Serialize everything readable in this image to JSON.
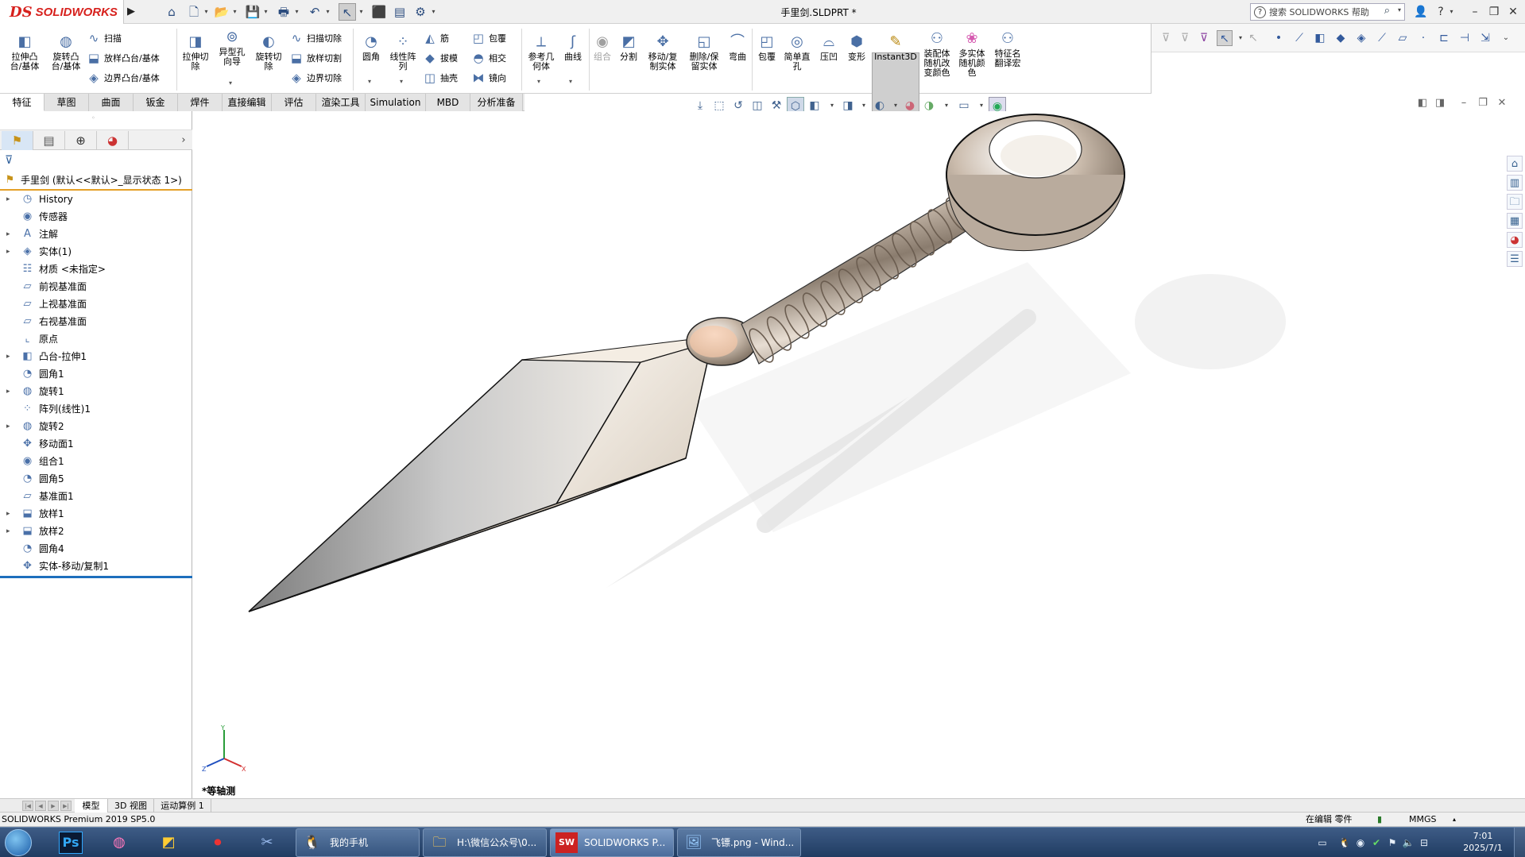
{
  "app": {
    "logo_ds": "DS",
    "logo_text": "SOLIDWORKS",
    "doc_title": "手里剑.SLDPRT *",
    "search_placeholder": "搜索 SOLIDWORKS 帮助"
  },
  "ribbon": {
    "big_buttons": [
      {
        "id": "extrude-boss",
        "label": "拉伸凸\n台/基体",
        "icon": "extrude-boss-icon"
      },
      {
        "id": "revolve-boss",
        "label": "旋转凸\n台/基体",
        "icon": "revolve-boss-icon"
      },
      {
        "id": "extrude-cut",
        "label": "拉伸切\n除",
        "icon": "extrude-cut-icon"
      },
      {
        "id": "hole-wizard",
        "label": "异型孔\n向导",
        "icon": "hole-wizard-icon"
      },
      {
        "id": "revolve-cut",
        "label": "旋转切\n除",
        "icon": "revolve-cut-icon"
      },
      {
        "id": "fillet",
        "label": "圆角",
        "icon": "fillet-icon"
      },
      {
        "id": "linear-pattern",
        "label": "线性阵\n列",
        "icon": "linear-pattern-icon"
      },
      {
        "id": "ref-geometry",
        "label": "参考几\n何体",
        "icon": "reference-geometry-icon"
      },
      {
        "id": "curves",
        "label": "曲线",
        "icon": "curves-icon"
      },
      {
        "id": "combine",
        "label": "组合",
        "icon": "combine-icon"
      },
      {
        "id": "split",
        "label": "分割",
        "icon": "split-icon"
      },
      {
        "id": "move-copy-body",
        "label": "移动/复\n制实体",
        "icon": "move-copy-body-icon"
      },
      {
        "id": "delete-keep-body",
        "label": "删除/保\n留实体",
        "icon": "delete-keep-body-icon"
      },
      {
        "id": "flex",
        "label": "弯曲",
        "icon": "flex-icon"
      },
      {
        "id": "wrap",
        "label": "包覆",
        "icon": "wrap-icon"
      },
      {
        "id": "simple-hole",
        "label": "简单直\n孔",
        "icon": "simple-hole-icon"
      },
      {
        "id": "indent",
        "label": "压凹",
        "icon": "indent-icon"
      },
      {
        "id": "deform",
        "label": "变形",
        "icon": "deform-icon"
      },
      {
        "id": "instant3d",
        "label": "Instant3D",
        "icon": "instant3d-icon"
      },
      {
        "id": "assembly-random-color",
        "label": "装配体\n随机改\n变颜色",
        "icon": "assembly-color-icon"
      },
      {
        "id": "multibody-random-color",
        "label": "多实体\n随机颜\n色",
        "icon": "multibody-color-icon"
      },
      {
        "id": "feature-name-translate",
        "label": "特征名\n翻译宏",
        "icon": "macro-icon"
      }
    ],
    "small_buttons": [
      {
        "id": "sweep",
        "label": "扫描",
        "icon": "sweep-icon"
      },
      {
        "id": "loft-boss",
        "label": "放样凸台/基体",
        "icon": "loft-boss-icon"
      },
      {
        "id": "boundary-boss",
        "label": "边界凸台/基体",
        "icon": "boundary-boss-icon"
      },
      {
        "id": "swept-cut",
        "label": "扫描切除",
        "icon": "swept-cut-icon"
      },
      {
        "id": "lofted-cut",
        "label": "放样切割",
        "icon": "lofted-cut-icon"
      },
      {
        "id": "boundary-cut",
        "label": "边界切除",
        "icon": "boundary-cut-icon"
      },
      {
        "id": "rib",
        "label": "筋",
        "icon": "rib-icon"
      },
      {
        "id": "draft",
        "label": "拔模",
        "icon": "draft-icon"
      },
      {
        "id": "shell",
        "label": "抽壳",
        "icon": "shell-icon"
      },
      {
        "id": "wrap-small",
        "label": "包覆",
        "icon": "wrap-icon"
      },
      {
        "id": "intersect",
        "label": "相交",
        "icon": "intersect-icon"
      },
      {
        "id": "mirror",
        "label": "镜向",
        "icon": "mirror-icon"
      }
    ]
  },
  "command_tabs": [
    "特征",
    "草图",
    "曲面",
    "钣金",
    "焊件",
    "直接编辑",
    "评估",
    "渲染工具",
    "Simulation",
    "MBD",
    "分析准备"
  ],
  "feature_tree": {
    "root": "手里剑  (默认<<默认>_显示状态 1>)",
    "items": [
      {
        "label": "History",
        "icon": "history-icon",
        "expand": true
      },
      {
        "label": "传感器",
        "icon": "sensor-icon",
        "expand": false
      },
      {
        "label": "注解",
        "icon": "annotation-icon",
        "expand": true
      },
      {
        "label": "实体(1)",
        "icon": "solid-bodies-icon",
        "expand": true
      },
      {
        "label": "材质 <未指定>",
        "icon": "material-icon",
        "expand": false
      },
      {
        "label": "前视基准面",
        "icon": "plane-icon",
        "expand": false
      },
      {
        "label": "上视基准面",
        "icon": "plane-icon",
        "expand": false
      },
      {
        "label": "右视基准面",
        "icon": "plane-icon",
        "expand": false
      },
      {
        "label": "原点",
        "icon": "origin-icon",
        "expand": false
      },
      {
        "label": "凸台-拉伸1",
        "icon": "extrude-boss-icon",
        "expand": true
      },
      {
        "label": "圆角1",
        "icon": "fillet-icon",
        "expand": false
      },
      {
        "label": "旋转1",
        "icon": "revolve-icon",
        "expand": true
      },
      {
        "label": "阵列(线性)1",
        "icon": "linear-pattern-icon",
        "expand": false
      },
      {
        "label": "旋转2",
        "icon": "revolve-icon",
        "expand": true
      },
      {
        "label": "移动面1",
        "icon": "move-face-icon",
        "expand": false
      },
      {
        "label": "组合1",
        "icon": "combine-icon",
        "expand": false
      },
      {
        "label": "圆角5",
        "icon": "fillet-icon",
        "expand": false
      },
      {
        "label": "基准面1",
        "icon": "plane-icon",
        "expand": false
      },
      {
        "label": "放样1",
        "icon": "loft-icon",
        "expand": true
      },
      {
        "label": "放样2",
        "icon": "loft-icon",
        "expand": true
      },
      {
        "label": "圆角4",
        "icon": "fillet-icon",
        "expand": false
      },
      {
        "label": "实体-移动/复制1",
        "icon": "move-copy-body-icon",
        "expand": false
      }
    ]
  },
  "viewport": {
    "view_label": "*等轴测"
  },
  "bottom_tabs": [
    "模型",
    "3D 视图",
    "运动算例 1"
  ],
  "status": {
    "product": "SOLIDWORKS Premium 2019 SP5.0",
    "editing": "在编辑 零件",
    "units": "MMGS"
  },
  "taskbar": {
    "apps": [
      {
        "label": "我的手机",
        "icon": "qq-icon"
      },
      {
        "label": "H:\\微信公众号\\0...",
        "icon": "folder-icon"
      },
      {
        "label": "SOLIDWORKS P...",
        "icon": "solidworks-icon"
      },
      {
        "label": "飞镖.png - Wind...",
        "icon": "image-viewer-icon"
      }
    ],
    "clock_time": "7:01",
    "clock_date": "2025/7/1"
  }
}
